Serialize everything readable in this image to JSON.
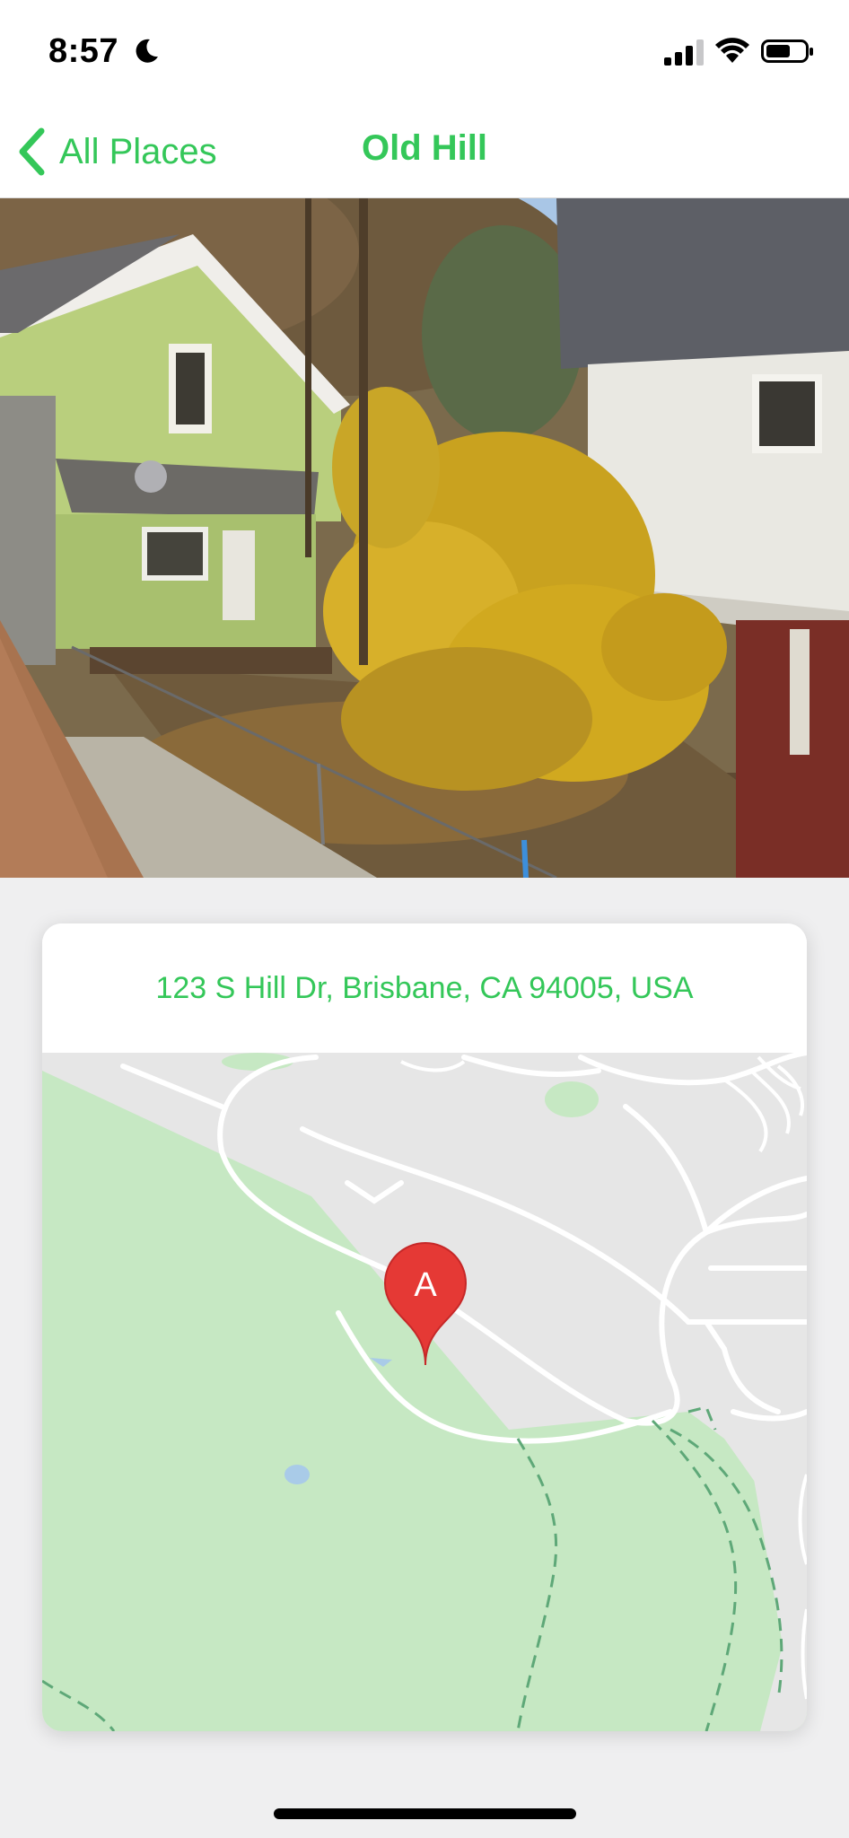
{
  "status_bar": {
    "time": "8:57",
    "icons": [
      "moon-icon",
      "cellular-signal-icon",
      "wifi-icon",
      "battery-icon"
    ]
  },
  "nav": {
    "back_label": "All Places",
    "title": "Old Hill",
    "accent_color": "#34c759"
  },
  "photo": {
    "description_icon": "place-photo"
  },
  "location": {
    "address": "123 S Hill Dr, Brisbane, CA 94005, USA",
    "marker_label": "A",
    "marker_color": "#e53935"
  }
}
